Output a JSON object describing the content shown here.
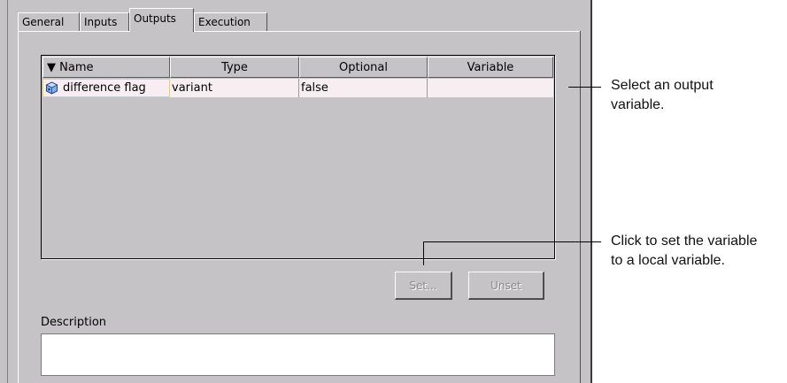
{
  "tabs": [
    {
      "label": "General"
    },
    {
      "label": "Inputs"
    },
    {
      "label": "Outputs"
    },
    {
      "label": "Execution"
    }
  ],
  "active_tab": "Outputs",
  "table": {
    "sort_indicator": "▼",
    "columns": [
      "Name",
      "Type",
      "Optional",
      "Variable"
    ],
    "rows": [
      {
        "icon": "variant-variable-icon",
        "name": "difference flag",
        "type": "variant",
        "optional": "false",
        "variable": ""
      }
    ]
  },
  "buttons": {
    "set_label": "Set...",
    "unset_label": "Unset"
  },
  "description": {
    "label": "Description",
    "value": ""
  },
  "callouts": {
    "select_line1": "Select an output",
    "select_line2": "variable.",
    "set_line1": "Click to set the variable",
    "set_line2": "to a local variable."
  },
  "colors": {
    "panel_bg": "#c5c3c6",
    "selected_row_bg": "#f6eef0",
    "selected_cell_border": "#e3d84a",
    "disabled_text": "#8a8a8a"
  }
}
